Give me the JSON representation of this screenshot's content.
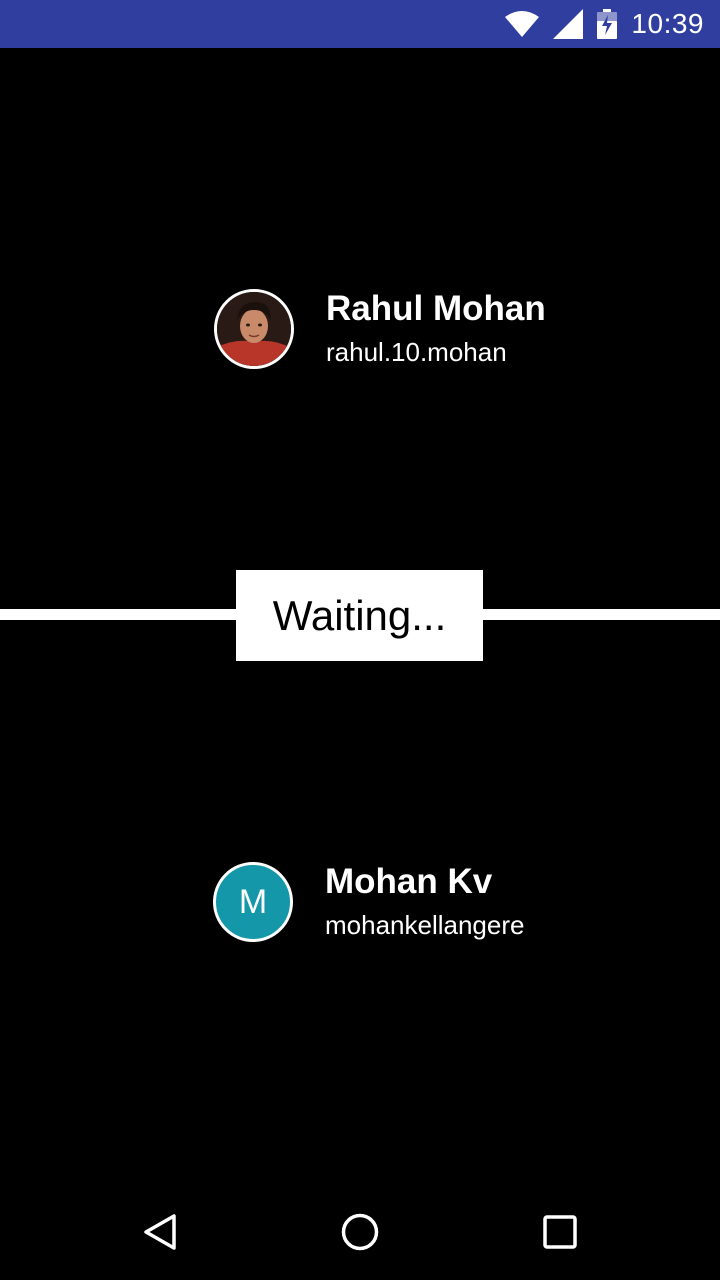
{
  "status_bar": {
    "time": "10:39",
    "background_color": "#303F9F",
    "icons": [
      "wifi-icon",
      "signal-icon",
      "battery-icon"
    ]
  },
  "players": {
    "top": {
      "name": "Rahul Mohan",
      "username": "rahul.10.mohan",
      "avatar_type": "photo"
    },
    "bottom": {
      "name": "Mohan Kv",
      "username": "mohankellangere",
      "avatar_initial": "M",
      "avatar_color": "#1497A8"
    }
  },
  "status": {
    "label": "Waiting..."
  },
  "nav_bar": {
    "icons": [
      "back-icon",
      "home-icon",
      "recents-icon"
    ]
  }
}
